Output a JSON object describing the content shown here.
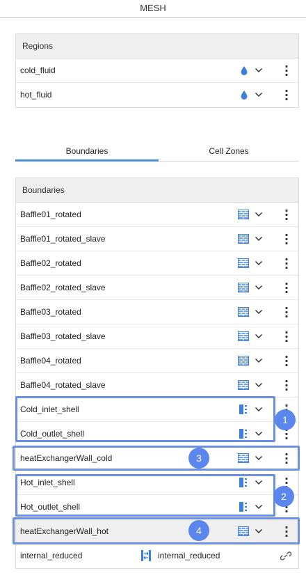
{
  "title": "MESH",
  "regions": {
    "header": "Regions",
    "items": [
      {
        "label": "cold_fluid",
        "icon": "fluid-drop-icon"
      },
      {
        "label": "hot_fluid",
        "icon": "fluid-drop-icon"
      }
    ]
  },
  "tabs": [
    {
      "label": "Boundaries",
      "active": true
    },
    {
      "label": "Cell Zones",
      "active": false
    }
  ],
  "boundaries": {
    "header": "Boundaries",
    "items": [
      {
        "label": "Baffle01_rotated",
        "icon": "wall-icon"
      },
      {
        "label": "Baffle01_rotated_slave",
        "icon": "wall-icon"
      },
      {
        "label": "Baffle02_rotated",
        "icon": "wall-icon"
      },
      {
        "label": "Baffle02_rotated_slave",
        "icon": "wall-icon"
      },
      {
        "label": "Baffle03_rotated",
        "icon": "wall-icon"
      },
      {
        "label": "Baffle03_rotated_slave",
        "icon": "wall-icon"
      },
      {
        "label": "Baffle04_rotated",
        "icon": "wall-icon"
      },
      {
        "label": "Baffle04_rotated_slave",
        "icon": "wall-icon"
      },
      {
        "label": "Cold_inlet_shell",
        "icon": "inlet-outlet-icon"
      },
      {
        "label": "Cold_outlet_shell",
        "icon": "inlet-outlet-icon"
      },
      {
        "label": "heatExchangerWall_cold",
        "icon": "wall-icon"
      },
      {
        "label": "Hot_inlet_shell",
        "icon": "inlet-outlet-icon"
      },
      {
        "label": "Hot_outlet_shell",
        "icon": "inlet-outlet-icon"
      },
      {
        "label": "heatExchangerWall_hot",
        "icon": "wall-icon"
      },
      {
        "label": "internal_reduced",
        "icon": "interface-icon",
        "type_label": "internal_reduced"
      }
    ]
  },
  "badges": [
    "1",
    "2",
    "3",
    "4"
  ],
  "colors": {
    "accent": "#4a90d9",
    "highlight": "#6b8fe6",
    "badge": "#5b86ee",
    "icon": "#3d7fd9"
  }
}
